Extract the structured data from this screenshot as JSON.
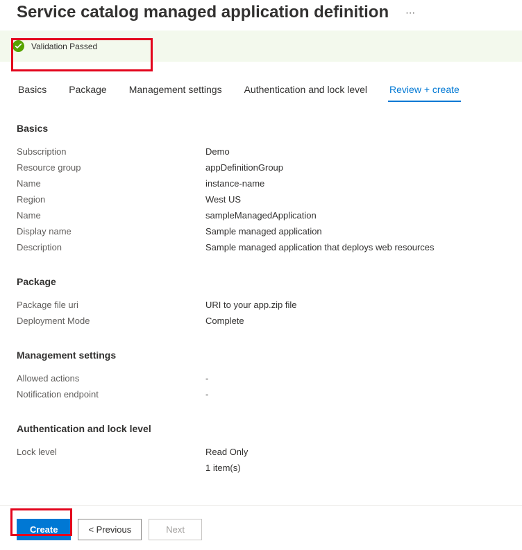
{
  "header": {
    "title": "Service catalog managed application definition",
    "moreIcon": "⋯"
  },
  "validation": {
    "status": "Validation Passed"
  },
  "tabs": {
    "basics": "Basics",
    "package": "Package",
    "management": "Management settings",
    "auth": "Authentication and lock level",
    "review": "Review + create"
  },
  "sections": {
    "basics": {
      "heading": "Basics",
      "rows": {
        "subscription": {
          "label": "Subscription",
          "value": "Demo"
        },
        "resourceGroup": {
          "label": "Resource group",
          "value": "appDefinitionGroup"
        },
        "name1": {
          "label": "Name",
          "value": "instance-name"
        },
        "region": {
          "label": "Region",
          "value": "West US"
        },
        "name2": {
          "label": "Name",
          "value": "sampleManagedApplication"
        },
        "displayName": {
          "label": "Display name",
          "value": "Sample managed application"
        },
        "description": {
          "label": "Description",
          "value": "Sample managed application that deploys web resources"
        }
      }
    },
    "package": {
      "heading": "Package",
      "rows": {
        "fileUri": {
          "label": "Package file uri",
          "value": "URI to your app.zip file"
        },
        "deploymentMode": {
          "label": "Deployment Mode",
          "value": "Complete"
        }
      }
    },
    "management": {
      "heading": "Management settings",
      "rows": {
        "allowedActions": {
          "label": "Allowed actions",
          "value": "-"
        },
        "notificationEndpoint": {
          "label": "Notification endpoint",
          "value": "-"
        }
      }
    },
    "auth": {
      "heading": "Authentication and lock level",
      "rows": {
        "lockLevel": {
          "label": "Lock level",
          "value": "Read Only"
        },
        "items": {
          "label": "",
          "value": "1 item(s)"
        }
      }
    }
  },
  "footer": {
    "create": "Create",
    "previous": "< Previous",
    "next": "Next"
  }
}
